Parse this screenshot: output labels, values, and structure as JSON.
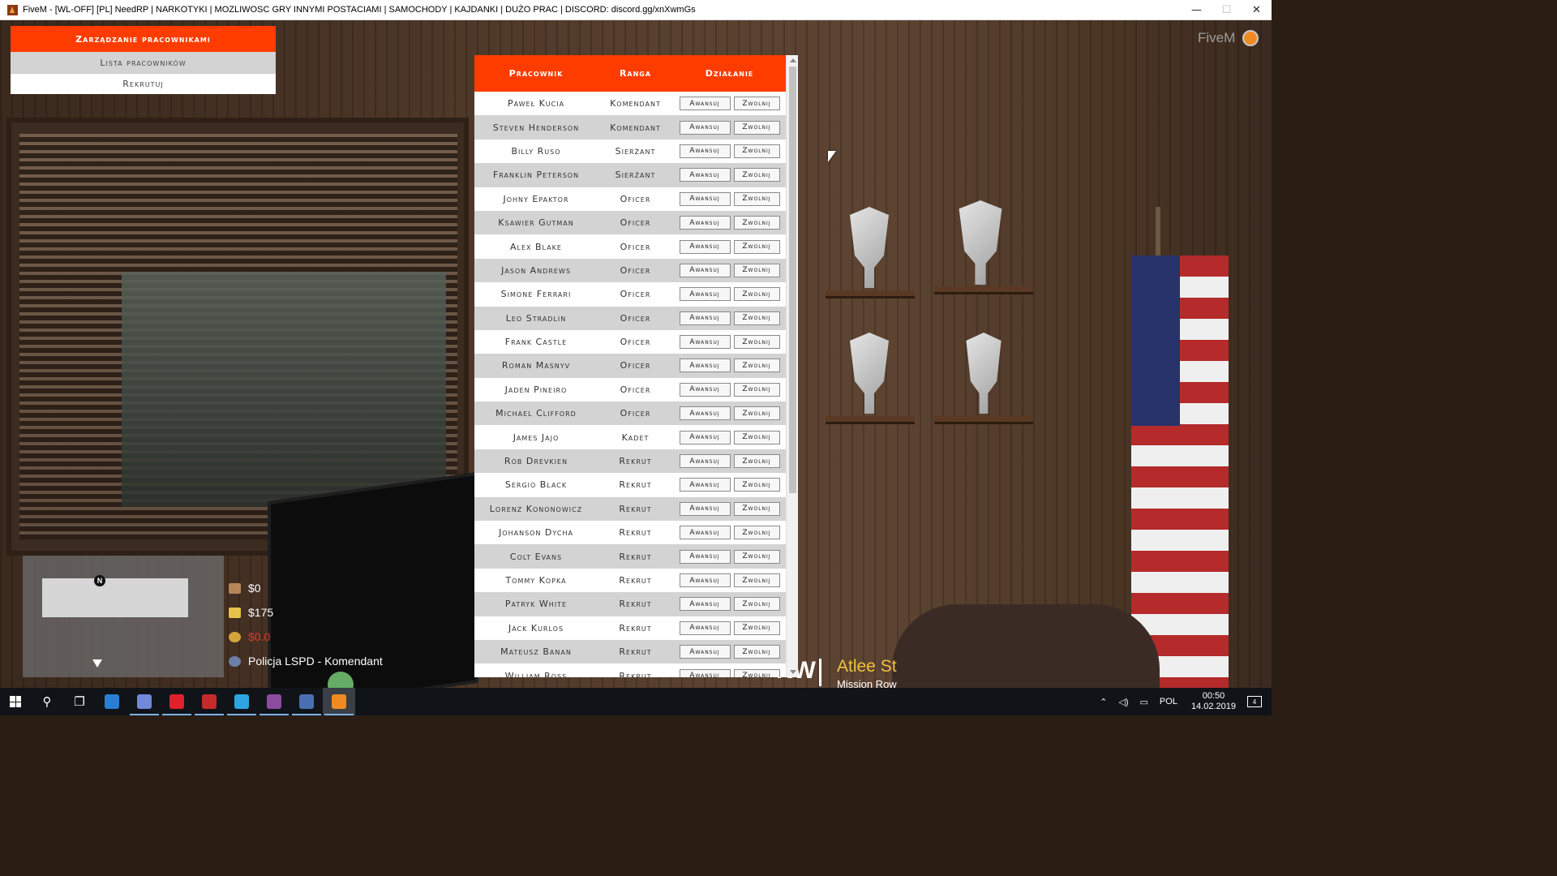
{
  "window": {
    "title": "FiveM - [WL-OFF] [PL] NeedRP | NARKOTYKI | MOZLIWOSC GRY INNYMI POSTACIAMI | SAMOCHODY | KAJDANKI | DUŻO PRAC | DISCORD: discord.gg/xnXwmGs",
    "minimize": "—",
    "maximize": "☐",
    "close": "✕"
  },
  "overlay": {
    "brand": "FiveM"
  },
  "menu": {
    "header": "Zarządzanie pracownikami",
    "items": [
      {
        "label": "Lista pracowników"
      },
      {
        "label": "Rekrutuj"
      }
    ]
  },
  "table": {
    "headers": {
      "employee": "Pracownik",
      "rank": "Ranga",
      "action": "Działanie"
    },
    "promote_label": "Awansuj",
    "fire_label": "Zwolnij",
    "rows": [
      {
        "name": "Paweł Kucia",
        "rank": "Komendant"
      },
      {
        "name": "Steven Henderson",
        "rank": "Komendant"
      },
      {
        "name": "Billy Ruso",
        "rank": "Sierżant"
      },
      {
        "name": "Franklin Peterson",
        "rank": "Sierżant"
      },
      {
        "name": "Johny Epaktor",
        "rank": "Oficer"
      },
      {
        "name": "Ksawier Gutman",
        "rank": "Oficer"
      },
      {
        "name": "Alex Blake",
        "rank": "Oficer"
      },
      {
        "name": "Jason Andrews",
        "rank": "Oficer"
      },
      {
        "name": "Simone Ferrari",
        "rank": "Oficer"
      },
      {
        "name": "Leo Stradlin",
        "rank": "Oficer"
      },
      {
        "name": "Frank Castle",
        "rank": "Oficer"
      },
      {
        "name": "Roman Masnyv",
        "rank": "Oficer"
      },
      {
        "name": "Jaden Pineiro",
        "rank": "Oficer"
      },
      {
        "name": "Michael Clifford",
        "rank": "Oficer"
      },
      {
        "name": "James Jajo",
        "rank": "Kadet"
      },
      {
        "name": "Rob Drevkien",
        "rank": "Rekrut"
      },
      {
        "name": "Sergio Black",
        "rank": "Rekrut"
      },
      {
        "name": "Lorenz Kononowicz",
        "rank": "Rekrut"
      },
      {
        "name": "Johanson Dycha",
        "rank": "Rekrut"
      },
      {
        "name": "Colt Evans",
        "rank": "Rekrut"
      },
      {
        "name": "Tommy Kopka",
        "rank": "Rekrut"
      },
      {
        "name": "Patryk White",
        "rank": "Rekrut"
      },
      {
        "name": "Jack Kurlos",
        "rank": "Rekrut"
      },
      {
        "name": "Mateusz Banan",
        "rank": "Rekrut"
      },
      {
        "name": "William Ross",
        "rank": "Rekrut"
      }
    ]
  },
  "hud": {
    "cash": "$0",
    "bank": "$175",
    "black_money": "$0.0",
    "job": "Policja LSPD - Komendant",
    "compass": "N"
  },
  "street": {
    "direction": "NW",
    "name": "Atlee St",
    "area": "Mission Row"
  },
  "taskbar": {
    "apps": [
      "search-icon",
      "task-view-icon",
      "edge-icon",
      "discord-icon",
      "opera-icon",
      "filezilla-icon",
      "telegram-icon",
      "winrar-icon",
      "network-tool-icon",
      "fivem-icon"
    ],
    "language": "POL",
    "time": "00:50",
    "date": "14.02.2019",
    "notifications": "4"
  },
  "colors": {
    "accent": "#ff3c00",
    "row_alt": "#d3d3d3"
  }
}
